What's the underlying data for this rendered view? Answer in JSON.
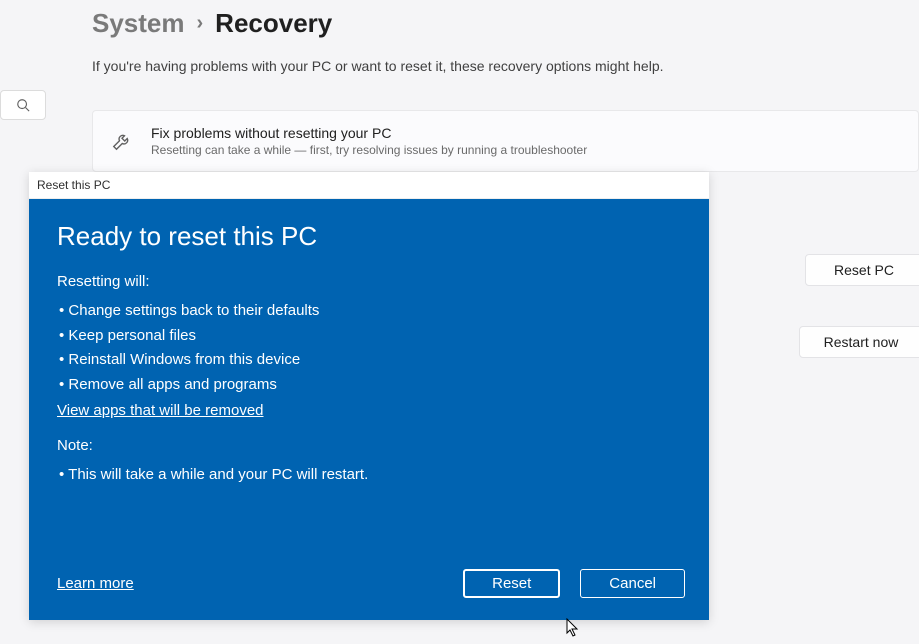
{
  "breadcrumb": {
    "parent": "System",
    "current": "Recovery"
  },
  "help_text": "If you're having problems with your PC or want to reset it, these recovery options might help.",
  "troubleshoot_card": {
    "title": "Fix problems without resetting your PC",
    "sub": "Resetting can take a while — first, try resolving issues by running a troubleshooter"
  },
  "buttons": {
    "reset_pc": "Reset PC",
    "restart_now": "Restart now"
  },
  "dialog": {
    "titlebar": "Reset this PC",
    "heading": "Ready to reset this PC",
    "resetting_label": "Resetting will:",
    "bullets": [
      "Change settings back to their defaults",
      "Keep personal files",
      "Reinstall Windows from this device",
      "Remove all apps and programs"
    ],
    "view_apps_link": "View apps that will be removed",
    "note_label": "Note:",
    "note_bullets": [
      "This will take a while and your PC will restart."
    ],
    "learn_more": "Learn more",
    "reset_btn": "Reset",
    "cancel_btn": "Cancel"
  }
}
